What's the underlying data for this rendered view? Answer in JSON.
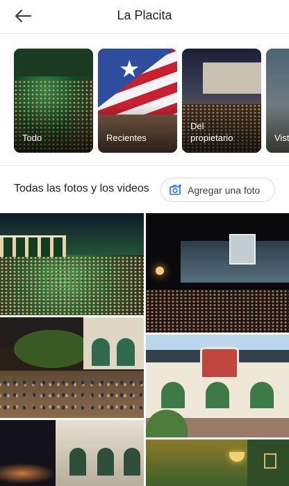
{
  "header": {
    "title": "La Placita",
    "back_icon": "arrow-back-icon"
  },
  "category_tiles": [
    {
      "label": "Todo",
      "selected": true
    },
    {
      "label": "Recientes",
      "selected": false
    },
    {
      "label": "Del\npropietario",
      "label_line1": "Del",
      "label_line2": "propietario",
      "selected": false
    },
    {
      "label": "Vist",
      "selected": false
    }
  ],
  "section": {
    "title": "Todas las fotos y los videos",
    "add_photo_label": "Agregar una foto",
    "add_photo_icon": "add-photo-camera-icon"
  },
  "colors": {
    "accent": "#1a73e8",
    "text": "#202124",
    "divider": "#e8eaed"
  }
}
